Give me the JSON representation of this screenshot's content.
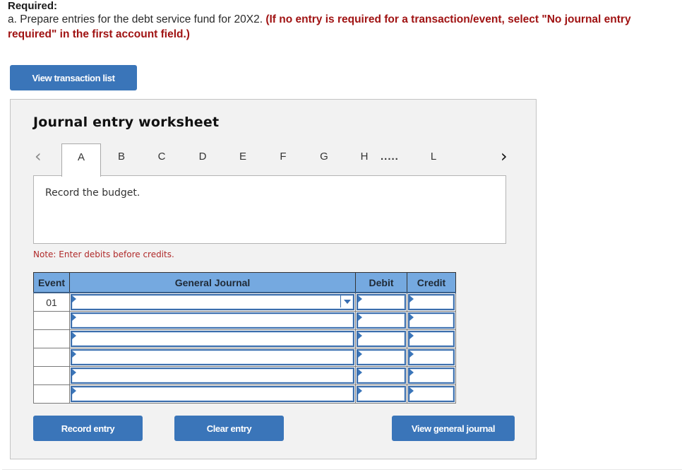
{
  "header": {
    "required_label": "Required:",
    "instruction_main": "a. Prepare entries for the debt service fund for 20X2. ",
    "instruction_emphasis": "(If no entry is required for a transaction/event, select \"No journal entry required\" in the first account field.)"
  },
  "buttons": {
    "view_transaction_list": "View transaction list",
    "record_entry": "Record entry",
    "clear_entry": "Clear entry",
    "view_general_journal": "View general journal"
  },
  "worksheet": {
    "title": "Journal entry worksheet",
    "tabs": [
      "A",
      "B",
      "C",
      "D",
      "E",
      "F",
      "G",
      "H",
      "L"
    ],
    "active_tab": "A",
    "ellipsis": ".....",
    "prev_icon": "chevron-left-icon",
    "next_icon": "chevron-right-icon",
    "description": "Record the budget.",
    "note": "Note: Enter debits before credits."
  },
  "journal_table": {
    "columns": [
      "Event",
      "General Journal",
      "Debit",
      "Credit"
    ],
    "rows": [
      {
        "event": "01",
        "account": "",
        "debit": "",
        "credit": ""
      },
      {
        "event": "",
        "account": "",
        "debit": "",
        "credit": ""
      },
      {
        "event": "",
        "account": "",
        "debit": "",
        "credit": ""
      },
      {
        "event": "",
        "account": "",
        "debit": "",
        "credit": ""
      },
      {
        "event": "",
        "account": "",
        "debit": "",
        "credit": ""
      },
      {
        "event": "",
        "account": "",
        "debit": "",
        "credit": ""
      }
    ]
  },
  "colors": {
    "primary_button": "#3a75b9",
    "table_header": "#75a9e0",
    "emphasis_red": "#a01313",
    "note_red": "#b02a2a"
  }
}
